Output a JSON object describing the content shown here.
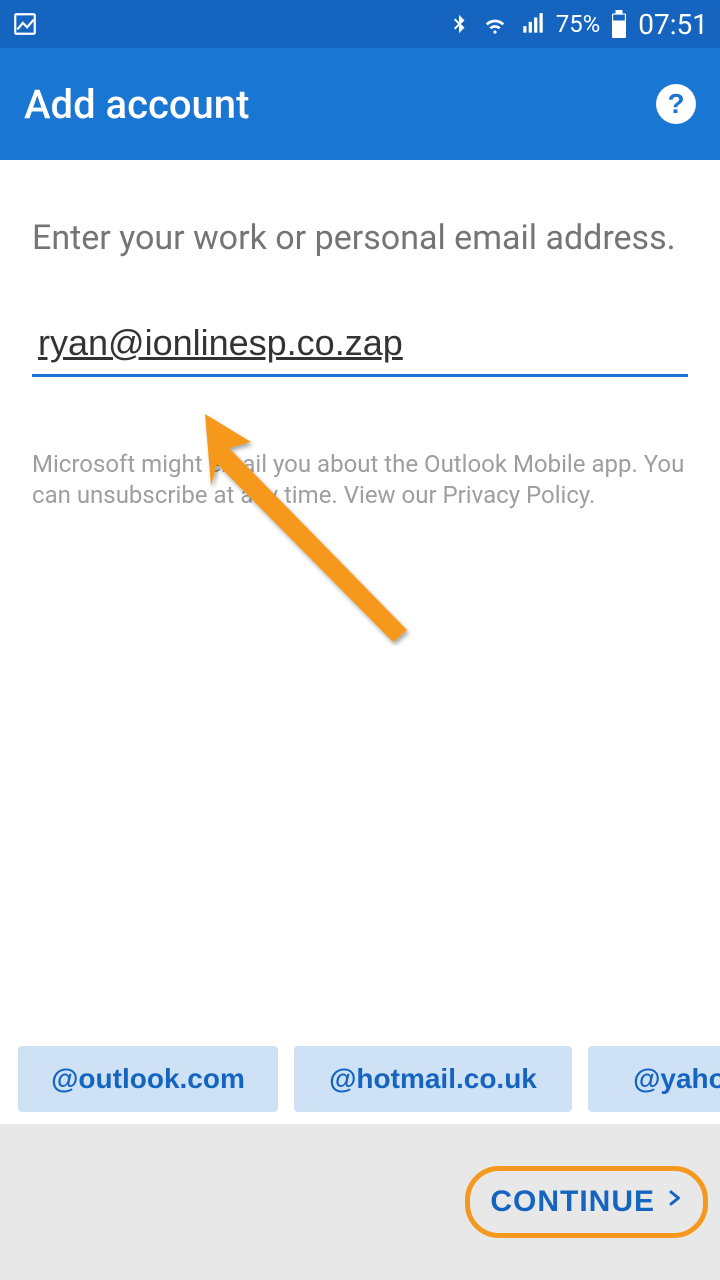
{
  "status_bar": {
    "battery_text": "75%",
    "time": "07:51"
  },
  "app_bar": {
    "title": "Add account"
  },
  "content": {
    "prompt": "Enter your work or personal email address.",
    "email_value": "ryan@ionlinesp.co.zap",
    "disclaimer": "Microsoft might email you about the Outlook Mobile app. You can unsubscribe at any time. View our Privacy Policy."
  },
  "suggestions": {
    "items": [
      {
        "label": "@outlook.com"
      },
      {
        "label": "@hotmail.co.uk"
      },
      {
        "label": "@yahoo"
      }
    ]
  },
  "bottom_bar": {
    "continue_label": "CONTINUE"
  }
}
